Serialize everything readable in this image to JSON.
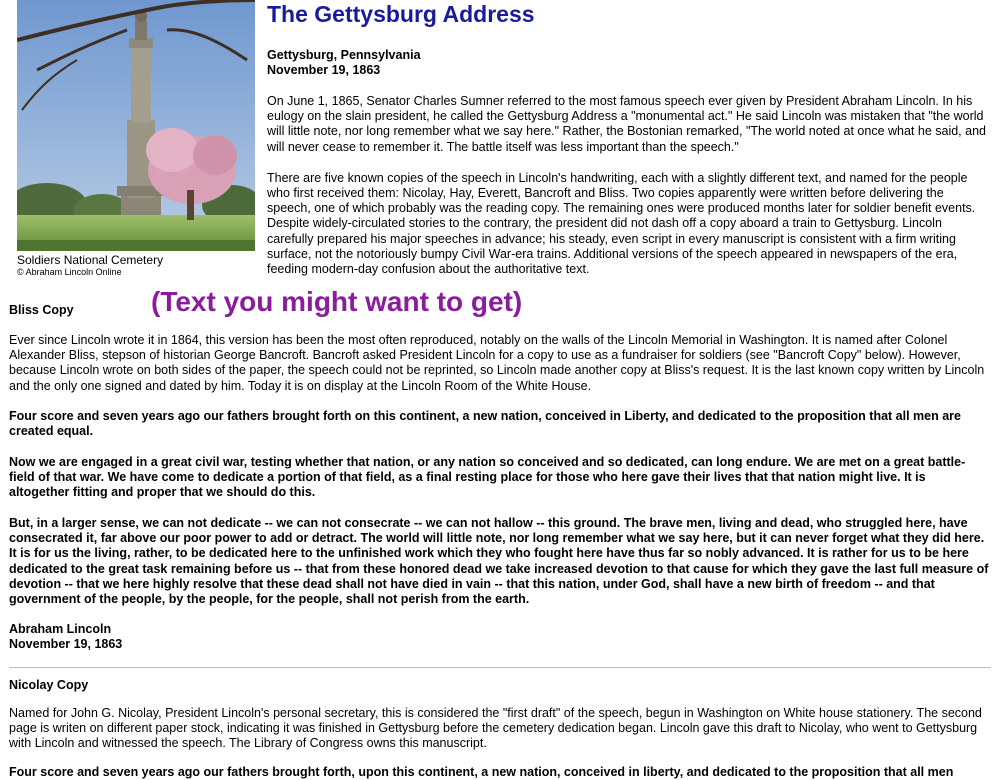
{
  "page": {
    "title": "The Gettysburg Address",
    "location": "Gettysburg, Pennsylvania",
    "date": "November 19, 1863"
  },
  "photo": {
    "caption": "Soldiers National Cemetery",
    "copyright": "© Abraham Lincoln Online"
  },
  "intro": {
    "p1": "On June 1, 1865, Senator Charles Sumner referred to the most famous speech ever given by President Abraham Lincoln. In his eulogy on the slain president, he called the Gettysburg Address a \"monumental act.\" He said Lincoln was mistaken that \"the world will little note, nor long remember what we say here.\" Rather, the Bostonian remarked, \"The world noted at once what he said, and will never cease to remember it. The battle itself was less important than the speech.\"",
    "p2": "There are five known copies of the speech in Lincoln's handwriting, each with a slightly different text, and named for the people who first received them: Nicolay, Hay, Everett, Bancroft and Bliss. Two copies apparently were written before delivering the speech, one of which probably was the reading copy. The remaining ones were produced months later for soldier benefit events. Despite widely-circulated stories to the contrary, the president did not dash off a copy aboard a train to Gettysburg. Lincoln carefully prepared his major speeches in advance; his steady, even script in every manuscript is consistent with a firm writing surface, not the notoriously bumpy Civil War-era trains. Additional versions of the speech appeared in newspapers of the era, feeding modern-day confusion about the authoritative text."
  },
  "annotation": "(Text you might want to get)",
  "bliss": {
    "heading": "Bliss Copy",
    "description": "Ever since Lincoln wrote it in 1864, this version has been the most often reproduced, notably on the walls of the Lincoln Memorial in Washington. It is named after Colonel Alexander Bliss, stepson of historian George Bancroft. Bancroft asked President Lincoln for a copy to use as a fundraiser for soldiers (see \"Bancroft Copy\" below). However, because Lincoln wrote on both sides of the paper, the speech could not be reprinted, so Lincoln made another copy at Bliss's request. It is the last known copy written by Lincoln and the only one signed and dated by him. Today it is on display at the Lincoln Room of the White House.",
    "speech_p1": "Four score and seven years ago our fathers brought forth on this continent, a new nation, conceived in Liberty, and dedicated to the proposition that all men are created equal.",
    "speech_p2": "Now we are engaged in a great civil war, testing whether that nation, or any nation so conceived and so dedicated, can long endure. We are met on a great battle-field of that war. We have come to dedicate a portion of that field, as a final resting place for those who here gave their lives that that nation might live. It is altogether fitting and proper that we should do this.",
    "speech_p3": "But, in a larger sense, we can not dedicate -- we can not consecrate -- we can not hallow -- this ground. The brave men, living and dead, who struggled here, have consecrated it, far above our poor power to add or detract. The world will little note, nor long remember what we say here, but it can never forget what they did here. It is for us the living, rather, to be dedicated here to the unfinished work which they who fought here have thus far so nobly advanced. It is rather for us to be here dedicated to the great task remaining before us -- that from these honored dead we take increased devotion to that cause for which they gave the last full measure of devotion -- that we here highly resolve that these dead shall not have died in vain -- that this nation, under God, shall have a new birth of freedom -- and that government of the people, by the people, for the people, shall not perish from the earth.",
    "signature_name": "Abraham Lincoln",
    "signature_date": "November 19, 1863"
  },
  "nicolay": {
    "heading": "Nicolay Copy",
    "description": "Named for John G. Nicolay, President Lincoln's personal secretary, this is considered the \"first draft\" of the speech, begun in Washington on White house stationery. The second page is writen on different paper stock, indicating it was finished in Gettysburg before the cemetery dedication began. Lincoln gave this draft to Nicolay, who went to Gettysburg with Lincoln and witnessed the speech. The Library of Congress owns this manuscript.",
    "speech_p1": "Four score and seven years ago our fathers brought forth, upon this continent, a new nation, conceived in liberty, and dedicated to the proposition that all men"
  }
}
